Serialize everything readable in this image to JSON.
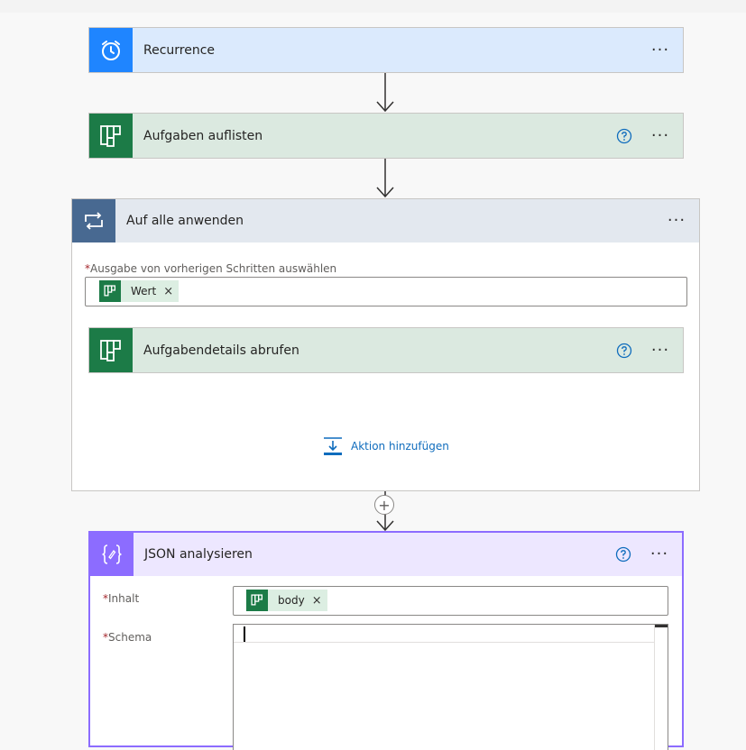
{
  "recurrence": {
    "title": "Recurrence",
    "icon": "alarm-clock-icon",
    "accent": "#1f85ff"
  },
  "list_tasks": {
    "title": "Aufgaben auflisten",
    "icon": "planner-icon",
    "accent": "#1c7b47"
  },
  "apply_to_each": {
    "title": "Auf alle anwenden",
    "icon": "loop-icon",
    "accent": "#486991",
    "select_label_required": "*",
    "select_label": "Ausgabe von vorherigen Schritten auswählen",
    "token_label": "Wert",
    "token_remove": "×",
    "inner_action": {
      "title": "Aufgabendetails abrufen",
      "icon": "planner-icon"
    },
    "add_action_label": "Aktion hinzufügen"
  },
  "insert_step": {
    "symbol": "+"
  },
  "parse_json": {
    "title": "JSON analysieren",
    "icon": "curly-braces-icon",
    "accent": "#8c6cff",
    "content_required": "*",
    "content_label": "Inhalt",
    "content_token": "body",
    "content_token_remove": "×",
    "schema_required": "*",
    "schema_label": "Schema",
    "schema_value": ""
  },
  "menu": {
    "more_label": "···"
  }
}
